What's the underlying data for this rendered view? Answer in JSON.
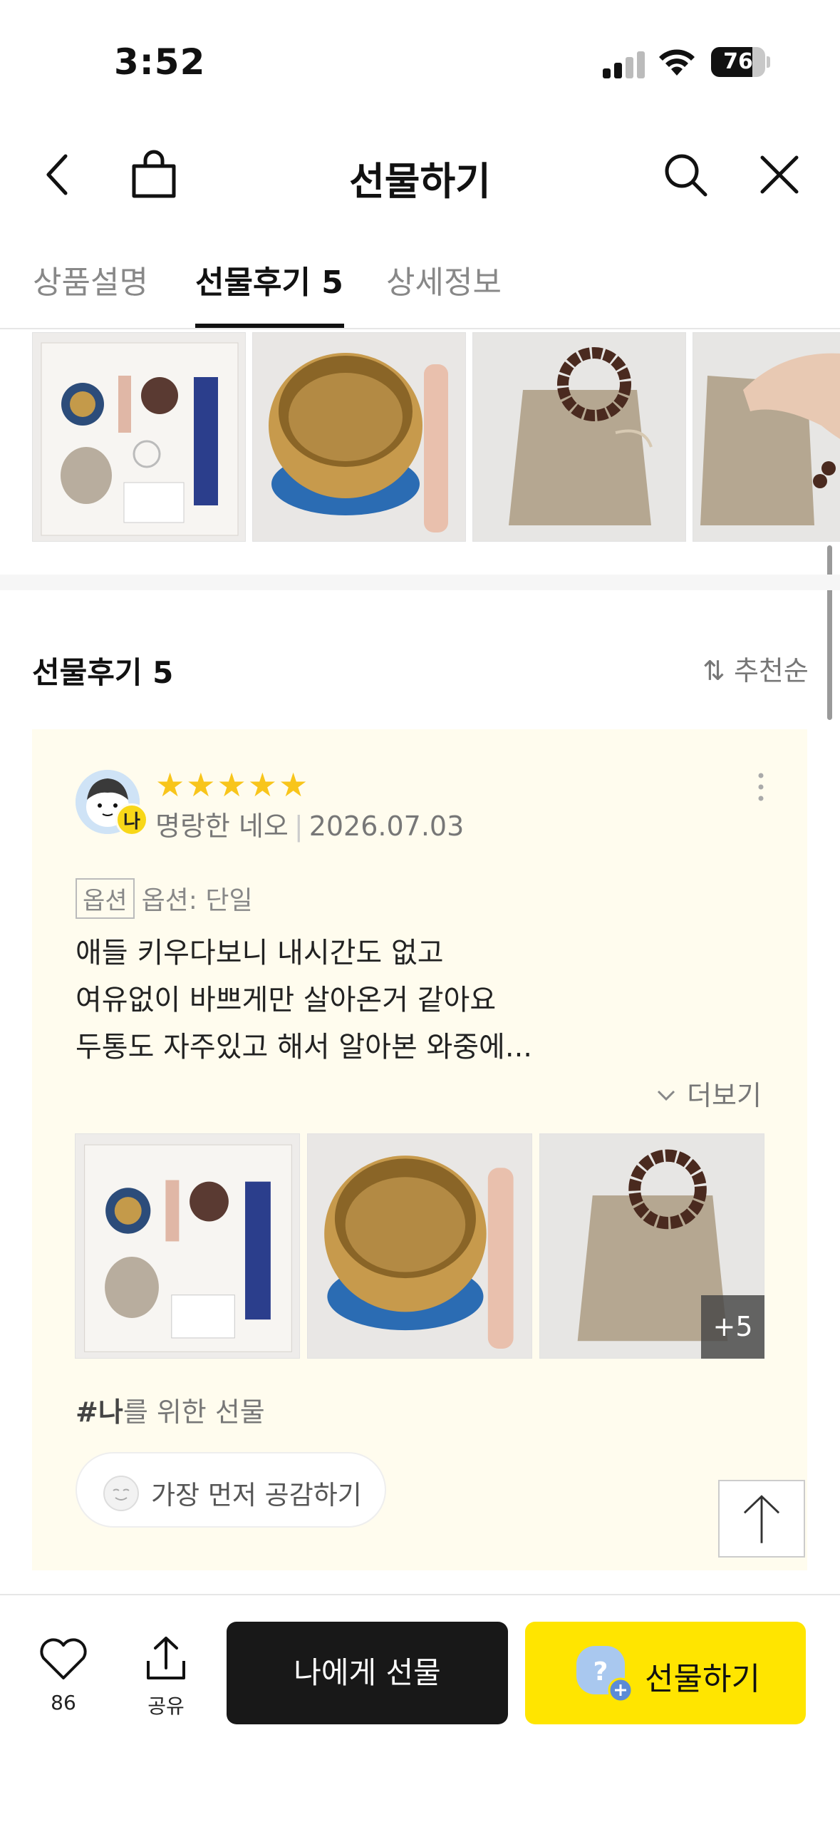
{
  "status_bar": {
    "time": "3:52",
    "battery": "76",
    "battery_level": 0.76
  },
  "nav": {
    "title": "선물하기"
  },
  "tabs": [
    {
      "label": "상품설명",
      "active": false
    },
    {
      "label": "선물후기 5",
      "active": true
    },
    {
      "label": "상세정보",
      "active": false
    }
  ],
  "review_section": {
    "title": "선물후기 5",
    "sort_label": "추천순"
  },
  "review": {
    "rating": 5,
    "stars": "★★★★★",
    "badge": "나",
    "author": "명랑한 네오",
    "date": "2026.07.03",
    "option_tag": "옵션",
    "option_text": "옵션: 단일",
    "lines": [
      "애들 키우다보니 내시간도 없고",
      "여유없이 바쁘게만 살아온거 같아요",
      "두통도 자주있고 해서 알아본 와중에..."
    ],
    "more_label": "더보기",
    "more_images": "+5",
    "hashtag_bold": "#나",
    "hashtag_rest": "를 위한 선물",
    "empathy_label": "가장 먼저 공감하기"
  },
  "bottom_bar": {
    "like_count": "86",
    "share_label": "공유",
    "self_gift_label": "나에게 선물",
    "gift_label": "선물하기"
  },
  "colors": {
    "accent": "#ffe500",
    "card_bg": "#fffcee",
    "star": "#f8c51b",
    "dark_button": "#181818"
  }
}
